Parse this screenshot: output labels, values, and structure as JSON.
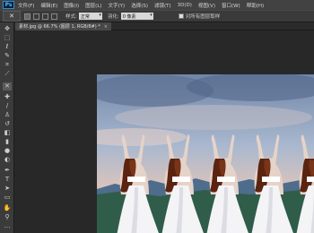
{
  "app": {
    "logo": "Ps"
  },
  "menu": [
    "文件(F)",
    "编辑(E)",
    "图像(I)",
    "图层(L)",
    "文字(Y)",
    "选择(S)",
    "滤镜(T)",
    "3D(D)",
    "视图(V)",
    "窗口(W)",
    "帮助(H)"
  ],
  "options": {
    "style_label": "样式:",
    "style_value": "正常",
    "feather_label": "羽化:",
    "feather_value": "0 像素",
    "antialias_label": "对所有图层取样"
  },
  "document": {
    "tab_title": "素材.jpg @ 66.7% (图层 1, RGB/8#) *",
    "close": "×"
  },
  "tools": [
    "move-icon",
    "marquee-icon",
    "lasso-icon",
    "quick-select-icon",
    "crop-icon",
    "eyedropper-icon",
    "healing-icon",
    "brush-icon",
    "stamp-icon",
    "history-brush-icon",
    "eraser-icon",
    "gradient-icon",
    "blur-icon",
    "dodge-icon",
    "pen-icon",
    "type-icon",
    "path-select-icon",
    "shape-icon",
    "hand-icon",
    "zoom-icon",
    "extra-icon",
    "foreground-color-icon",
    "quick-mask-icon"
  ],
  "colors": {
    "menubar": "#424242",
    "panel": "#3b3b3b",
    "canvas_bg": "#282828",
    "sky_top": "#6f86a8",
    "dress": "#f4f4f6",
    "hair": "#5a2410"
  }
}
